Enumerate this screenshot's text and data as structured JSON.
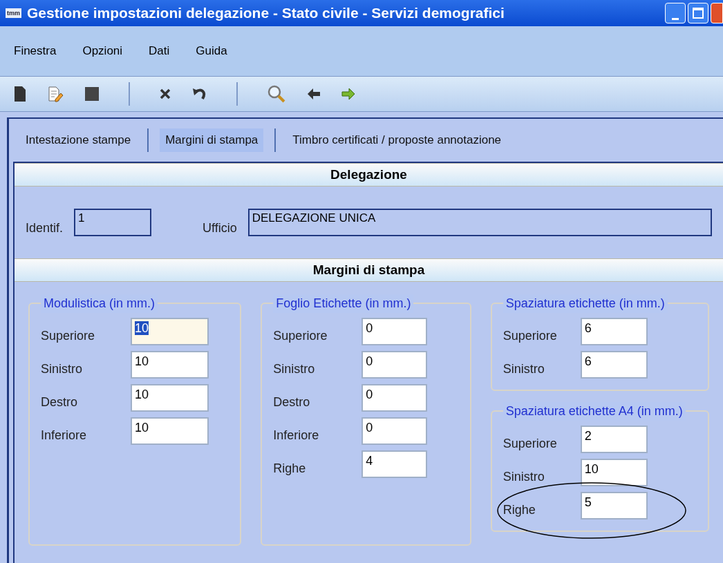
{
  "window": {
    "icon_text": "tmm",
    "title": "Gestione impostazioni delegazione - Stato civile - Servizi demografici"
  },
  "menu": [
    "Finestra",
    "Opzioni",
    "Dati",
    "Guida"
  ],
  "toolbar": [
    {
      "kind": "new"
    },
    {
      "kind": "edit"
    },
    {
      "kind": "stop"
    },
    {
      "kind": "separator"
    },
    {
      "kind": "delete"
    },
    {
      "kind": "undo"
    },
    {
      "kind": "separator"
    },
    {
      "kind": "search"
    },
    {
      "kind": "back"
    },
    {
      "kind": "forward"
    }
  ],
  "tabs": [
    {
      "label": "Intestazione stampe",
      "selected": false
    },
    {
      "label": "Margini di stampa",
      "selected": true
    },
    {
      "label": "Timbro certificati / proposte annotazione",
      "selected": false
    }
  ],
  "delegazione": {
    "title": "Delegazione",
    "identif_label": "Identif.",
    "identif_value": "1",
    "ufficio_label": "Ufficio",
    "ufficio_value": "DELEGAZIONE UNICA"
  },
  "margini": {
    "title": "Margini di stampa",
    "groups": [
      {
        "title": "Modulistica (in mm.)",
        "fields": [
          {
            "label": "Superiore",
            "value": "10",
            "focused": true
          },
          {
            "label": "Sinistro",
            "value": "10",
            "focused": false
          },
          {
            "label": "Destro",
            "value": "10",
            "focused": false
          },
          {
            "label": "Inferiore",
            "value": "10",
            "focused": false
          }
        ]
      },
      {
        "title": "Foglio Etichette (in mm.)",
        "fields": [
          {
            "label": "Superiore",
            "value": "0",
            "focused": false
          },
          {
            "label": "Sinistro",
            "value": "0",
            "focused": false
          },
          {
            "label": "Destro",
            "value": "0",
            "focused": false
          },
          {
            "label": "Inferiore",
            "value": "0",
            "focused": false
          },
          {
            "label": "Righe",
            "value": "4",
            "focused": false
          }
        ]
      },
      {
        "title": "Spaziatura etichette (in mm.)",
        "fields": [
          {
            "label": "Superiore",
            "value": "6",
            "focused": false
          },
          {
            "label": "Sinistro",
            "value": "6",
            "focused": false
          }
        ]
      },
      {
        "title": "Spaziatura etichette A4 (in mm.)",
        "fields": [
          {
            "label": "Superiore",
            "value": "2",
            "focused": false
          },
          {
            "label": "Sinistro",
            "value": "10",
            "focused": false
          },
          {
            "label": "Righe",
            "value": "5",
            "focused": false
          }
        ]
      }
    ]
  }
}
